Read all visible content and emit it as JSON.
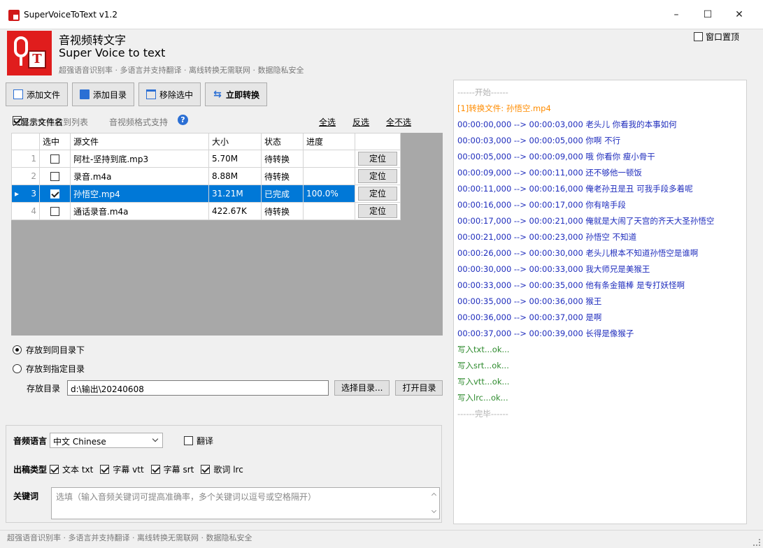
{
  "window": {
    "title": "SuperVoiceToText v1.2",
    "min": "–",
    "max": "☐",
    "close": "✕"
  },
  "header": {
    "title_cn": "音视频转文字",
    "title_en": "Super Voice to text",
    "slogan": "超强语音识别率 · 多语言并支持翻译 · 离线转换无需联网 · 数据隐私安全",
    "topmost_label": "窗口置顶",
    "logo_letter": "T"
  },
  "toolbar": {
    "add_file": "添加文件",
    "add_dir": "添加目录",
    "remove_selected": "移除选中",
    "convert_now": "立即转换"
  },
  "hints": {
    "drag": "可将文件拖放到列表",
    "formats": "音视频格式支持",
    "help_glyph": "?",
    "only_filename": "只显示文件名",
    "select_all": "全选",
    "invert": "反选",
    "select_none": "全不选"
  },
  "grid": {
    "headers": {
      "selected": "选中",
      "source": "源文件",
      "size": "大小",
      "status": "状态",
      "progress": "进度"
    },
    "locate_label": "定位",
    "current_marker": "▸",
    "rows": [
      {
        "num": "1",
        "checked": false,
        "file": "阿杜-坚持到底.mp3",
        "size": "5.70M",
        "status": "待转换",
        "progress": ""
      },
      {
        "num": "2",
        "checked": false,
        "file": "录音.m4a",
        "size": "8.88M",
        "status": "待转换",
        "progress": ""
      },
      {
        "num": "3",
        "checked": true,
        "file": "孙悟空.mp4",
        "size": "31.21M",
        "status": "已完成",
        "progress": "100.0%"
      },
      {
        "num": "4",
        "checked": false,
        "file": "通话录音.m4a",
        "size": "422.67K",
        "status": "待转换",
        "progress": ""
      }
    ]
  },
  "output": {
    "same_dir": "存放到同目录下",
    "custom_dir": "存放到指定目录",
    "dir_label": "存放目录",
    "dir_value": "d:\\输出\\20240608",
    "choose_dir": "选择目录...",
    "open_dir": "打开目录"
  },
  "settings": {
    "lang_label": "音频语言",
    "lang_value": "中文 Chinese",
    "translate": "翻译",
    "type_label": "出稿类型",
    "types": [
      "文本 txt",
      "字幕 vtt",
      "字幕 srt",
      "歌词 lrc"
    ],
    "keyword_label": "关键词",
    "keyword_placeholder": "选填（输入音频关键词可提高准确率，多个关键词以逗号或空格隔开）"
  },
  "log": [
    {
      "text": "------开始------",
      "color": "gray"
    },
    {
      "text": "[1]转换文件: 孙悟空.mp4",
      "color": "orange"
    },
    {
      "text": "00:00:00,000 --> 00:00:03,000  老头儿 你看我的本事如何",
      "color": "blue"
    },
    {
      "text": "00:00:03,000 --> 00:00:05,000  你啊 不行",
      "color": "blue"
    },
    {
      "text": "00:00:05,000 --> 00:00:09,000  哦 你看你 瘦小骨干",
      "color": "blue"
    },
    {
      "text": "00:00:09,000 --> 00:00:11,000  还不够他一顿饭",
      "color": "blue"
    },
    {
      "text": "00:00:11,000 --> 00:00:16,000  俺老孙丑是丑 可我手段多着呢",
      "color": "blue"
    },
    {
      "text": "00:00:16,000 --> 00:00:17,000  你有啥手段",
      "color": "blue"
    },
    {
      "text": "00:00:17,000 --> 00:00:21,000  俺就是大闹了天宫的齐天大圣孙悟空",
      "color": "blue"
    },
    {
      "text": "00:00:21,000 --> 00:00:23,000  孙悟空 不知道",
      "color": "blue"
    },
    {
      "text": "00:00:26,000 --> 00:00:30,000  老头儿根本不知道孙悟空是谁啊",
      "color": "blue"
    },
    {
      "text": "00:00:30,000 --> 00:00:33,000  我大师兄是美猴王",
      "color": "blue"
    },
    {
      "text": "00:00:33,000 --> 00:00:35,000  他有条金箍棒 是专打妖怪啊",
      "color": "blue"
    },
    {
      "text": "00:00:35,000 --> 00:00:36,000  猴王",
      "color": "blue"
    },
    {
      "text": "00:00:36,000 --> 00:00:37,000  是啊",
      "color": "blue"
    },
    {
      "text": "00:00:37,000 --> 00:00:39,000  长得是像猴子",
      "color": "blue"
    },
    {
      "text": "写入txt...ok...",
      "color": "green"
    },
    {
      "text": "写入srt...ok...",
      "color": "green"
    },
    {
      "text": "写入vtt...ok...",
      "color": "green"
    },
    {
      "text": "写入lrc...ok...",
      "color": "green"
    },
    {
      "text": "------完毕------",
      "color": "gray"
    }
  ],
  "statusbar": {
    "text": "超强语音识别率 · 多语言并支持翻译 · 离线转换无需联网 · 数据隐私安全"
  }
}
